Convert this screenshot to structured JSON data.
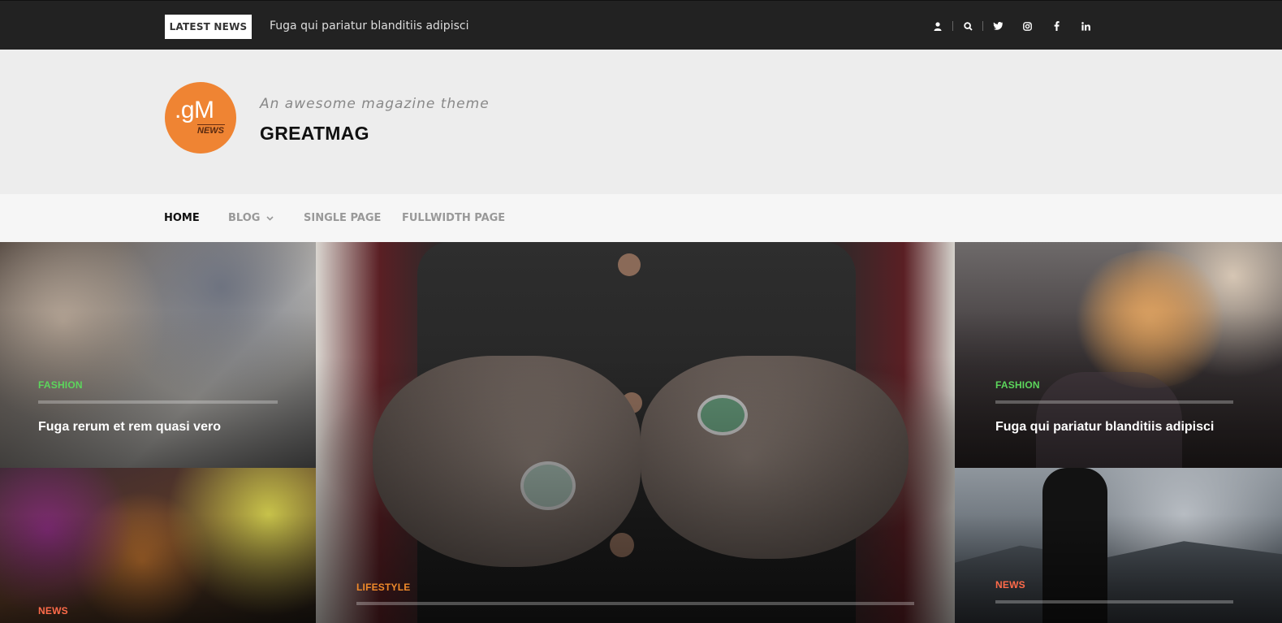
{
  "topbar": {
    "latest_label": "LATEST NEWS",
    "ticker": "Fuga qui pariatur blanditiis adipisci",
    "icons": [
      "user-icon",
      "search-icon",
      "twitter-icon",
      "instagram-icon",
      "facebook-icon",
      "linkedin-icon"
    ]
  },
  "header": {
    "logo_main": ".gM",
    "logo_sub": "NEWS",
    "tagline": "An awesome magazine theme",
    "site_title": "GREATMAG",
    "logo_color": "#ef8433"
  },
  "nav": {
    "items": [
      {
        "label": "HOME",
        "active": true
      },
      {
        "label": "BLOG",
        "has_dropdown": true
      },
      {
        "label": "SINGLE PAGE"
      },
      {
        "label": "FULLWIDTH PAGE"
      }
    ]
  },
  "posts": [
    {
      "category": "FASHION",
      "title": "Fuga rerum et rem quasi vero",
      "category_color": "#5cd65c"
    },
    {
      "category": "NEWS",
      "title": "",
      "category_color": "#ff6b4a"
    },
    {
      "category": "LIFESTYLE",
      "title": "",
      "category_color": "#f08a2a"
    },
    {
      "category": "FASHION",
      "title": "Fuga qui pariatur blanditiis adipisci",
      "category_color": "#5cd65c"
    },
    {
      "category": "NEWS",
      "title": "",
      "category_color": "#ff6b4a"
    }
  ]
}
